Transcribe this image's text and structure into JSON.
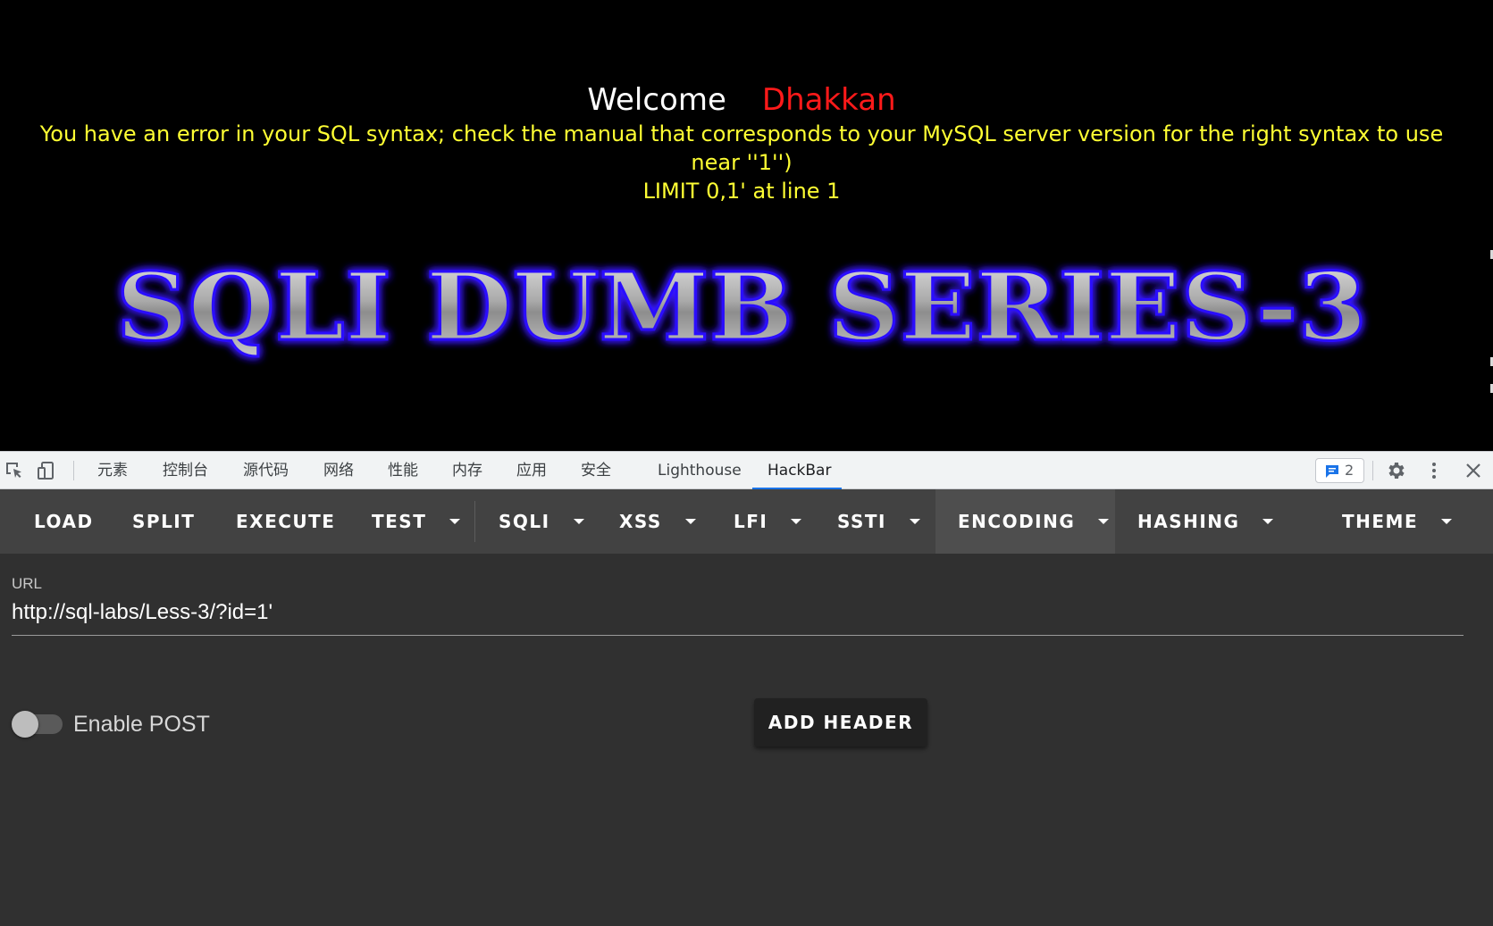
{
  "page": {
    "welcome_word": "Welcome",
    "welcome_name": "Dhakkan",
    "sql_error_line1": "You have an error in your SQL syntax; check the manual that corresponds to your MySQL server version for the right syntax to use near ''1'')",
    "sql_error_line2": "LIMIT 0,1' at line 1",
    "banner_text": "SQLI DUMB SERIES-3",
    "colors": {
      "background": "#000000",
      "welcome": "#ffffff",
      "name": "#ff1a1a",
      "error": "#ffff33",
      "banner_glow": "#3a1cff"
    }
  },
  "devtools": {
    "icons": [
      "inspect-element-icon",
      "device-toolbar-icon"
    ],
    "tabs": [
      {
        "label": "元素"
      },
      {
        "label": "控制台"
      },
      {
        "label": "源代码"
      },
      {
        "label": "网络"
      },
      {
        "label": "性能"
      },
      {
        "label": "内存"
      },
      {
        "label": "应用"
      },
      {
        "label": "安全"
      },
      {
        "label": "Lighthouse"
      },
      {
        "label": "HackBar"
      }
    ],
    "active_tab": "HackBar",
    "issues_count": "2",
    "right_icons": [
      "settings-gear-icon",
      "more-vertical-icon",
      "close-icon"
    ],
    "accent": "#1a73e8"
  },
  "hackbar": {
    "toolbar": {
      "load": "LOAD",
      "split": "SPLIT",
      "execute": "EXECUTE",
      "test": "TEST",
      "sqli": "SQLI",
      "xss": "XSS",
      "lfi": "LFI",
      "ssti": "SSTI",
      "encoding": "ENCODING",
      "hashing": "HASHING",
      "theme": "THEME"
    },
    "url_label": "URL",
    "url_value": "http://sql-labs/Less-3/?id=1'",
    "enable_post_label": "Enable POST",
    "enable_post": false,
    "add_header_label": "ADD HEADER"
  }
}
